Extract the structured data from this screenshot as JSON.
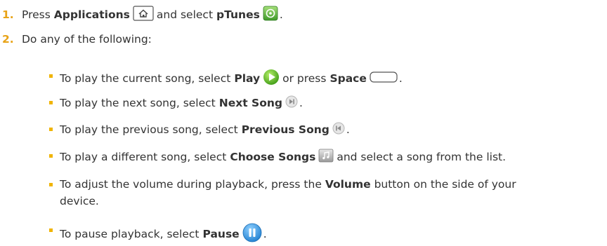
{
  "steps": [
    {
      "number": "1.",
      "pre": "Press",
      "strong1": "Applications",
      "mid": "and select",
      "strong2": "pTunes",
      "post": "."
    },
    {
      "number": "2.",
      "text": "Do any of the following:"
    }
  ],
  "bullets": [
    {
      "pre": "To play the current song, select",
      "strong": "Play",
      "mid": "or press",
      "strong2": "Space",
      "post": "."
    },
    {
      "pre": "To play the next song, select",
      "strong": "Next Song",
      "post": "."
    },
    {
      "pre": "To play the previous song, select",
      "strong": "Previous Song",
      "post": "."
    },
    {
      "pre": "To play a different song, select",
      "strong": "Choose Songs",
      "post": "and select a song from the list."
    },
    {
      "pre": "To adjust the volume during playback, press the",
      "strong": "Volume",
      "post": "button on the side of your device."
    },
    {
      "pre": "To pause playback, select",
      "strong": "Pause",
      "post": "."
    }
  ],
  "colors": {
    "step_number": "#e8a317",
    "bullet": "#f0b400",
    "text": "#333333"
  },
  "icons": [
    "home-key-icon",
    "ptunes-icon",
    "play-icon",
    "space-key-icon",
    "next-song-icon",
    "previous-song-icon",
    "choose-songs-icon",
    "pause-icon"
  ]
}
